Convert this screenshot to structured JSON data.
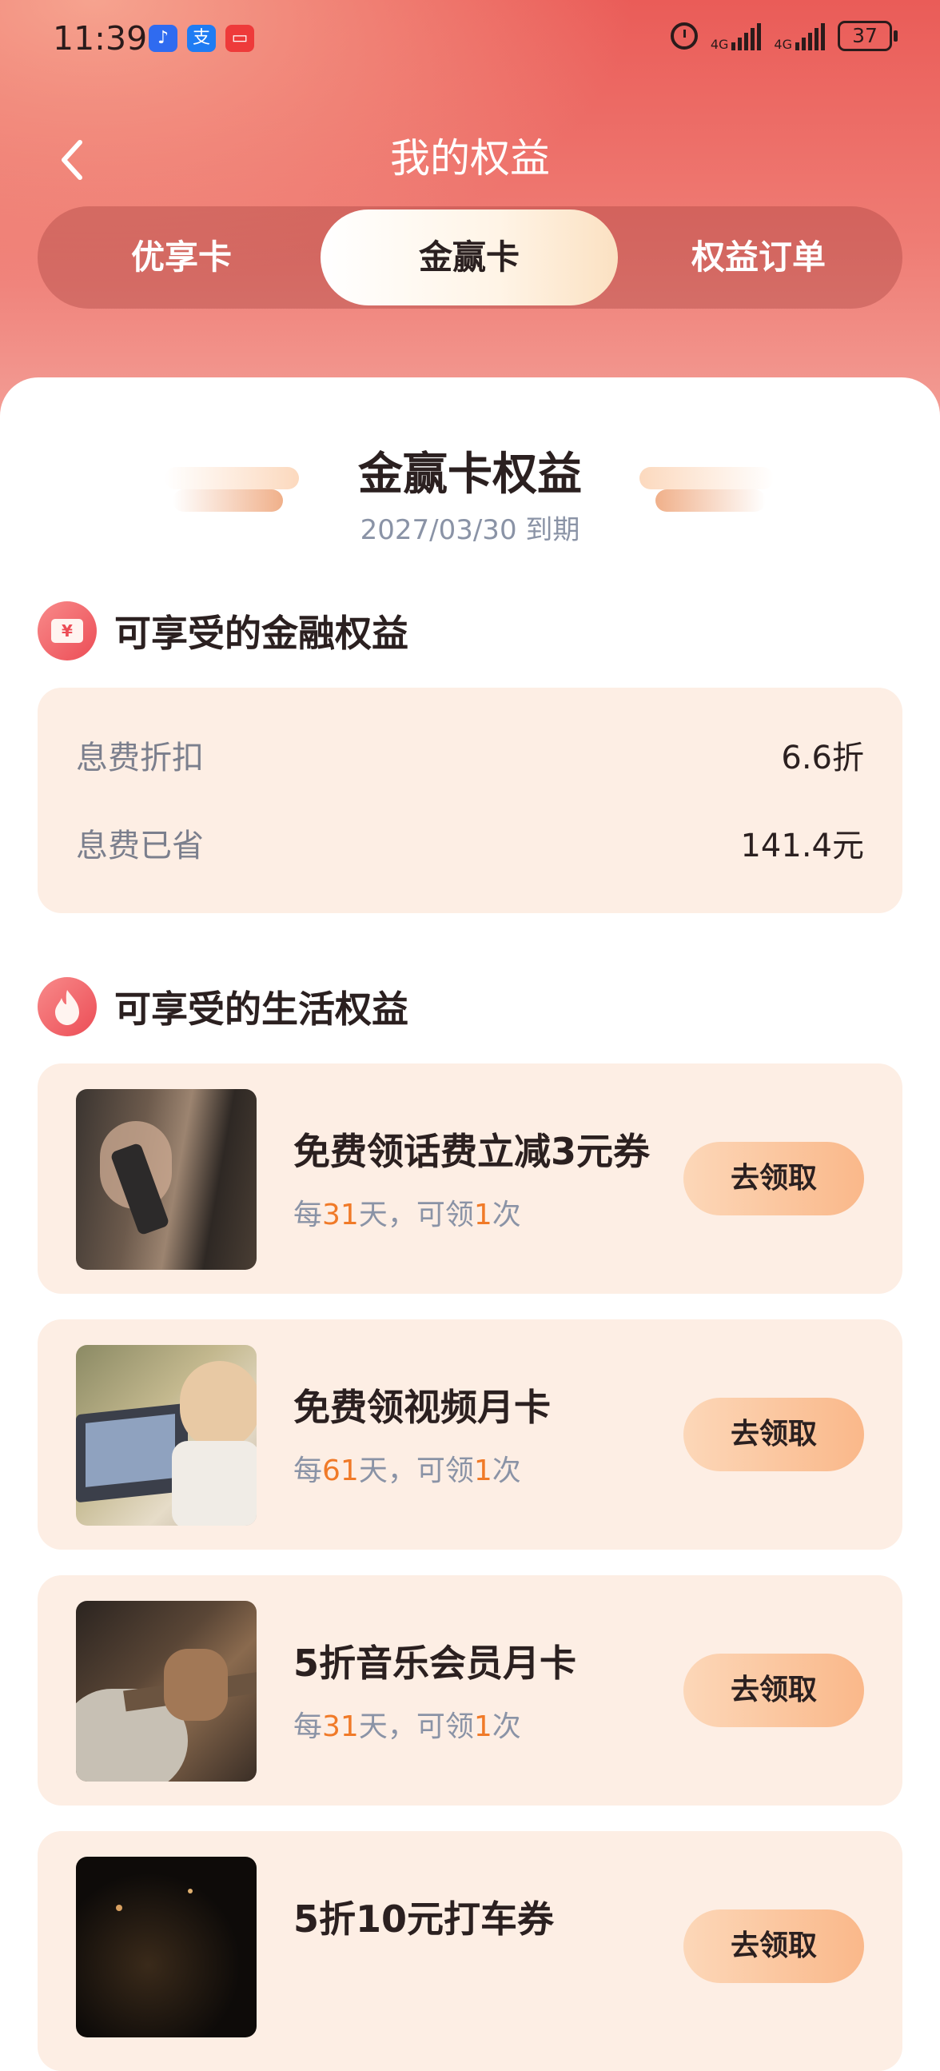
{
  "status_bar": {
    "time": "11:39",
    "battery": "37",
    "network_1": "4G",
    "network_2": "4G",
    "app_badges": [
      "voice-app-icon",
      "alipay-icon",
      "reader-app-icon"
    ]
  },
  "nav": {
    "title": "我的权益"
  },
  "tabs": [
    {
      "label": "优享卡",
      "active": false
    },
    {
      "label": "金赢卡",
      "active": true
    },
    {
      "label": "权益订单",
      "active": false
    }
  ],
  "header": {
    "title": "金赢卡权益",
    "expiry": "2027/03/30 到期"
  },
  "finance": {
    "section_title": "可享受的金融权益",
    "rows": [
      {
        "label": "息费折扣",
        "value": "6.6折"
      },
      {
        "label": "息费已省",
        "value": "141.4元"
      }
    ]
  },
  "life": {
    "section_title": "可享受的生活权益",
    "items": [
      {
        "title": "免费领话费立减3元券",
        "sub_prefix": "每",
        "days": "31",
        "sub_mid": "天，可领",
        "count": "1",
        "sub_suffix": "次",
        "button": "去领取"
      },
      {
        "title": "免费领视频月卡",
        "sub_prefix": "每",
        "days": "61",
        "sub_mid": "天，可领",
        "count": "1",
        "sub_suffix": "次",
        "button": "去领取"
      },
      {
        "title": "5折音乐会员月卡",
        "sub_prefix": "每",
        "days": "31",
        "sub_mid": "天，可领",
        "count": "1",
        "sub_suffix": "次",
        "button": "去领取"
      },
      {
        "title": "5折10元打车券",
        "button": "去领取"
      }
    ]
  },
  "colors": {
    "header_red": "#ea5c58",
    "accent_orange": "#f07a28",
    "item_bg": "#fdeee4"
  }
}
